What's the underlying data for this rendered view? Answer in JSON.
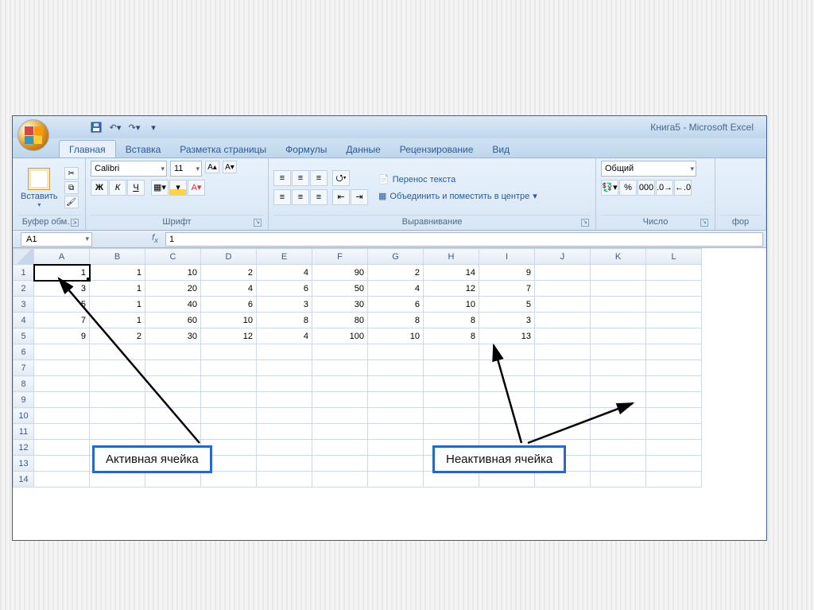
{
  "title": "Книга5 - Microsoft Excel",
  "tabs": [
    "Главная",
    "Вставка",
    "Разметка страницы",
    "Формулы",
    "Данные",
    "Рецензирование",
    "Вид"
  ],
  "clipboard": {
    "paste": "Вставить",
    "label": "Буфер обм…"
  },
  "font": {
    "name": "Calibri",
    "size": "11",
    "bold": "Ж",
    "italic": "К",
    "underline": "Ч",
    "label": "Шрифт"
  },
  "alignment": {
    "wrap": "Перенос текста",
    "merge": "Объединить и поместить в центре",
    "label": "Выравнивание"
  },
  "number": {
    "format": "Общий",
    "label": "Число"
  },
  "extra": {
    "label": "фор"
  },
  "namebox": "A1",
  "formula_value": "1",
  "columns": [
    "A",
    "B",
    "C",
    "D",
    "E",
    "F",
    "G",
    "H",
    "I",
    "J",
    "K",
    "L"
  ],
  "rows": [
    "1",
    "2",
    "3",
    "4",
    "5",
    "6",
    "7",
    "8",
    "9",
    "10",
    "11",
    "12",
    "13",
    "14"
  ],
  "chart_data": {
    "type": "table",
    "columns": [
      "A",
      "B",
      "C",
      "D",
      "E",
      "F",
      "G",
      "H",
      "I"
    ],
    "data": [
      [
        1,
        1,
        10,
        2,
        4,
        90,
        2,
        14,
        9
      ],
      [
        3,
        1,
        20,
        4,
        6,
        50,
        4,
        12,
        7
      ],
      [
        5,
        1,
        40,
        6,
        3,
        30,
        6,
        10,
        5
      ],
      [
        7,
        1,
        60,
        10,
        8,
        80,
        8,
        8,
        3
      ],
      [
        9,
        2,
        30,
        12,
        4,
        100,
        10,
        8,
        13
      ]
    ]
  },
  "callouts": {
    "active": "Активная ячейка",
    "inactive": "Неактивная ячейка"
  }
}
